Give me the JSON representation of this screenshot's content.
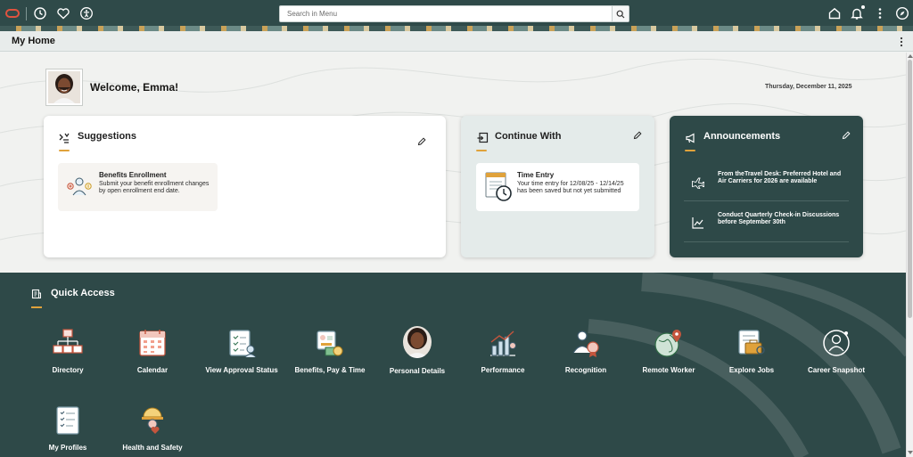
{
  "topbar": {
    "search_placeholder": "Search in Menu"
  },
  "page": {
    "title": "My Home"
  },
  "hero": {
    "welcome": "Welcome, Emma!",
    "date": "Thursday, December 11, 2025"
  },
  "suggestions": {
    "title": "Suggestions",
    "item": {
      "title": "Benefits Enrollment",
      "description": "Submit your benefit enrollment changes by open enrollment end date."
    }
  },
  "continue_with": {
    "title": "Continue With",
    "item": {
      "title": "Time Entry",
      "description": "Your time entry for 12/08/25 - 12/14/25 has been saved but not yet submitted"
    }
  },
  "announcements": {
    "title": "Announcements",
    "items": [
      {
        "text": "From theTravel Desk: Preferred Hotel and Air Carriers for 2026 are available",
        "icon": "airplane-icon"
      },
      {
        "text": "Conduct Quarterly Check-in Discussions before September 30th",
        "icon": "chart-icon"
      }
    ]
  },
  "quick_access": {
    "title": "Quick Access",
    "items": [
      {
        "label": "Directory",
        "icon": "directory-icon"
      },
      {
        "label": "Calendar",
        "icon": "calendar-icon"
      },
      {
        "label": "View Approval Status",
        "icon": "approval-status-icon"
      },
      {
        "label": "Benefits, Pay & Time",
        "icon": "benefits-pay-icon"
      },
      {
        "label": "Personal Details",
        "icon": "personal-details-photo"
      },
      {
        "label": "Performance",
        "icon": "performance-icon"
      },
      {
        "label": "Recognition",
        "icon": "recognition-icon"
      },
      {
        "label": "Remote Worker",
        "icon": "remote-worker-icon"
      },
      {
        "label": "Explore Jobs",
        "icon": "explore-jobs-icon"
      },
      {
        "label": "Career Snapshot",
        "icon": "career-snapshot-icon"
      },
      {
        "label": "My Profiles",
        "icon": "my-profiles-icon"
      },
      {
        "label": "Health and Safety",
        "icon": "health-safety-icon"
      }
    ]
  },
  "colors": {
    "brand_dark": "#2e4948",
    "accent": "#e0a23b",
    "oracle_red": "#c74634"
  }
}
